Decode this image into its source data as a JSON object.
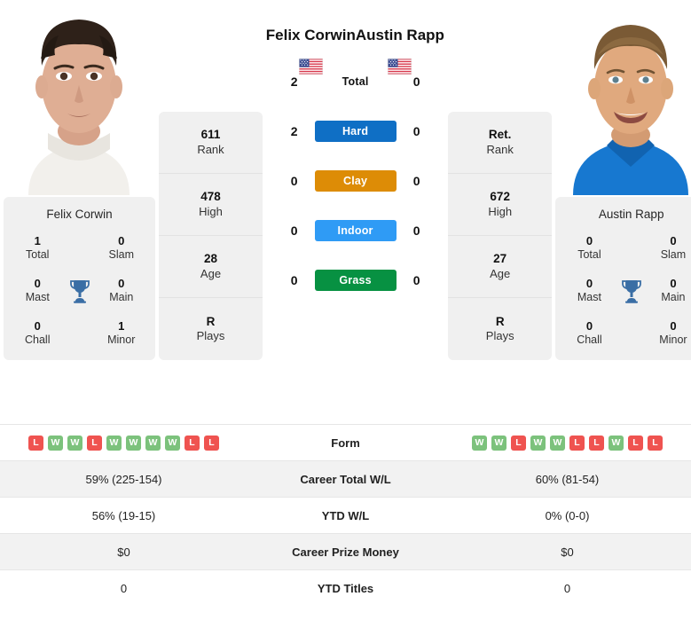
{
  "players": {
    "left": {
      "name": "Felix Corwin",
      "flag": "us-flag-icon",
      "card_name": "Felix Corwin",
      "titles": {
        "total_value": "1",
        "total_label": "Total",
        "slam_value": "0",
        "slam_label": "Slam",
        "mast_value": "0",
        "mast_label": "Mast",
        "main_value": "0",
        "main_label": "Main",
        "chall_value": "0",
        "chall_label": "Chall",
        "minor_value": "1",
        "minor_label": "Minor"
      },
      "stats": [
        {
          "value": "611",
          "label": "Rank"
        },
        {
          "value": "478",
          "label": "High"
        },
        {
          "value": "28",
          "label": "Age"
        },
        {
          "value": "R",
          "label": "Plays"
        }
      ],
      "form": [
        "L",
        "W",
        "W",
        "L",
        "W",
        "W",
        "W",
        "W",
        "L",
        "L"
      ],
      "career_wl": "59% (225-154)",
      "ytd_wl": "56% (19-15)",
      "career_prize": "$0",
      "ytd_titles": "0"
    },
    "right": {
      "name": "Austin Rapp",
      "flag": "us-flag-icon",
      "card_name": "Austin Rapp",
      "titles": {
        "total_value": "0",
        "total_label": "Total",
        "slam_value": "0",
        "slam_label": "Slam",
        "mast_value": "0",
        "mast_label": "Mast",
        "main_value": "0",
        "main_label": "Main",
        "chall_value": "0",
        "chall_label": "Chall",
        "minor_value": "0",
        "minor_label": "Minor"
      },
      "stats": [
        {
          "value": "Ret.",
          "label": "Rank"
        },
        {
          "value": "672",
          "label": "High"
        },
        {
          "value": "27",
          "label": "Age"
        },
        {
          "value": "R",
          "label": "Plays"
        }
      ],
      "form": [
        "W",
        "W",
        "L",
        "W",
        "W",
        "L",
        "L",
        "W",
        "L",
        "L"
      ],
      "career_wl": "60% (81-54)",
      "ytd_wl": "0% (0-0)",
      "career_prize": "$0",
      "ytd_titles": "0"
    }
  },
  "h2h": [
    {
      "label": "Total",
      "left": "2",
      "right": "0",
      "color": "",
      "plain": true
    },
    {
      "label": "Hard",
      "left": "2",
      "right": "0",
      "color": "#0f6fc5",
      "plain": false
    },
    {
      "label": "Clay",
      "left": "0",
      "right": "0",
      "color": "#dd8c06",
      "plain": false
    },
    {
      "label": "Indoor",
      "left": "0",
      "right": "0",
      "color": "#2f9bf5",
      "plain": false
    },
    {
      "label": "Grass",
      "left": "0",
      "right": "0",
      "color": "#079142",
      "plain": false
    }
  ],
  "table": {
    "form_label": "Form",
    "rows": [
      {
        "label": "Career Total W/L",
        "left": "59% (225-154)",
        "right": "60% (81-54)"
      },
      {
        "label": "YTD W/L",
        "left": "56% (19-15)",
        "right": "0% (0-0)"
      },
      {
        "label": "Career Prize Money",
        "left": "$0",
        "right": "$0"
      },
      {
        "label": "YTD Titles",
        "left": "0",
        "right": "0"
      }
    ]
  },
  "colors": {
    "win_badge": "#7cc27c",
    "loss_badge": "#ef5350",
    "card_bg": "#f0f0f0",
    "trophy": "#3a6ea5"
  }
}
